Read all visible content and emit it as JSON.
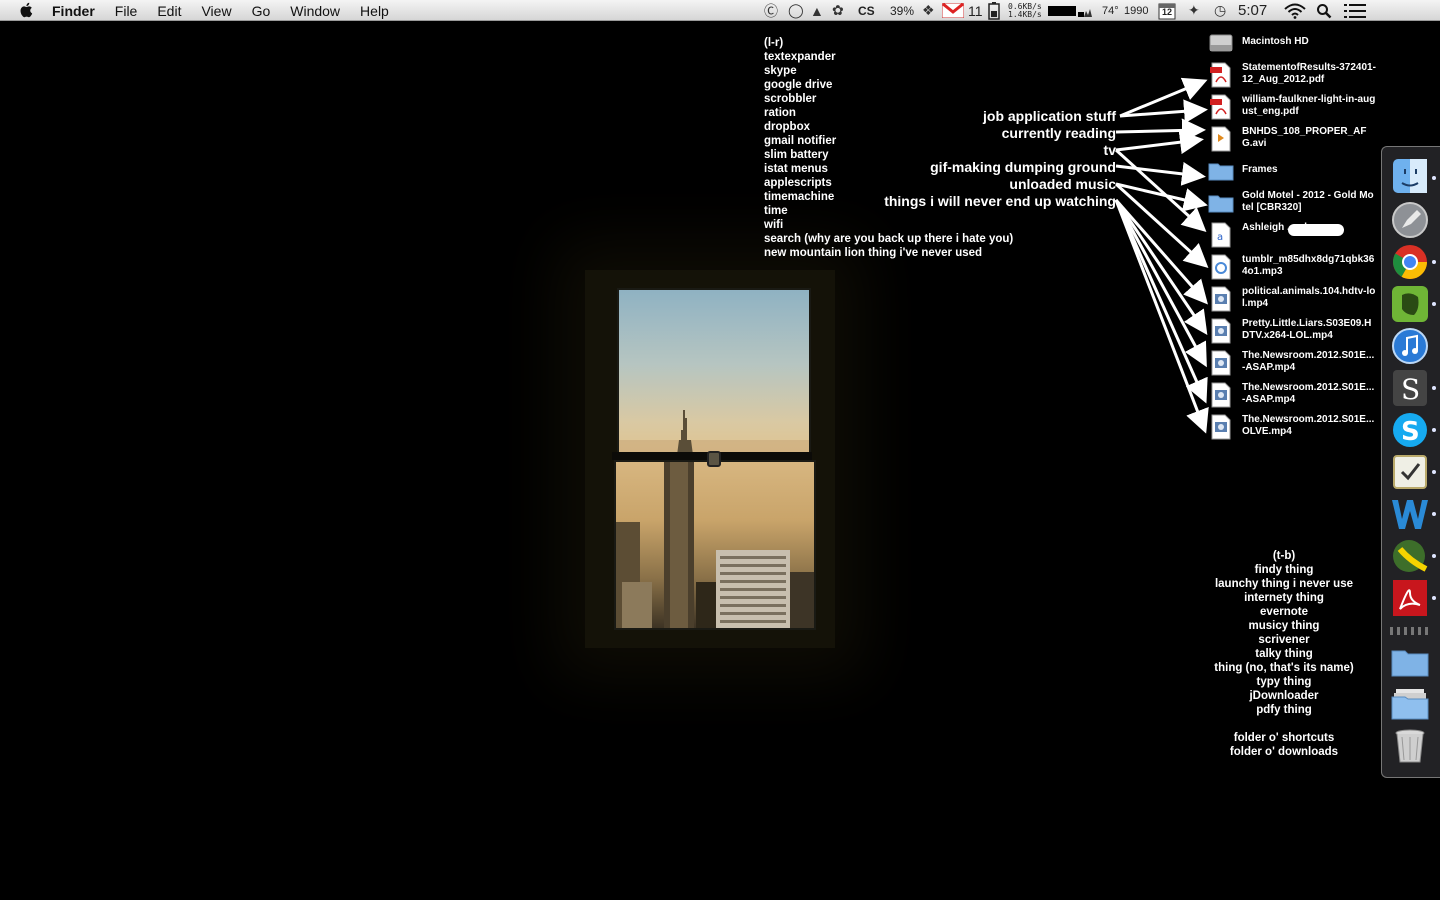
{
  "menubar": {
    "app": "Finder",
    "items": [
      "File",
      "Edit",
      "View",
      "Go",
      "Window",
      "Help"
    ],
    "battery_percent": "39%",
    "mail_count": "11",
    "net_up": "0.6KB/s",
    "net_down": "1.4KB/s",
    "temperature": "74°",
    "cpu_text": "1990",
    "calendar_day": "12",
    "clock": "5:07"
  },
  "note_lr": {
    "lines": [
      "(l-r)",
      "textexpander",
      "skype",
      "google drive",
      "scrobbler",
      "ration",
      "dropbox",
      "gmail notifier",
      "slim battery",
      "istat menus",
      "applescripts",
      "timemachine",
      "time",
      "wifi",
      "search (why are you back up there i hate you)",
      "new mountain lion thing i've never used"
    ]
  },
  "labels": {
    "job": "job application stuff",
    "reading": "currently reading",
    "tv": "tv",
    "gif": "gif-making dumping ground",
    "music": "unloaded music",
    "never": "things i will never end up watching"
  },
  "desktop": [
    {
      "name": "Macintosh HD",
      "icon": "hard-drive-icon"
    },
    {
      "name": "StatementofResults-372401-12_Aug_2012.pdf",
      "icon": "pdf-icon"
    },
    {
      "name": "william-faulkner-light-in-august_eng.pdf",
      "icon": "pdf-icon"
    },
    {
      "name": "BNHDS_108_PROPER_AFG.avi",
      "icon": "video-icon"
    },
    {
      "name": "Frames",
      "icon": "folder-icon"
    },
    {
      "name": "Gold Motel - 2012 - Gold Motel [CBR320]",
      "icon": "folder-icon"
    },
    {
      "name": "Ashleigh ... .docx",
      "icon": "document-icon"
    },
    {
      "name": "tumblr_m85dhx8dg71qbk364o1.mp3",
      "icon": "audio-icon"
    },
    {
      "name": "political.animals.104.hdtv-lol.mp4",
      "icon": "video-icon"
    },
    {
      "name": "Pretty.Little.Liars.S03E09.HDTV.x264-LOL.mp4",
      "icon": "video-icon"
    },
    {
      "name": "The.Newsroom.2012.S01E...-ASAP.mp4",
      "icon": "video-icon"
    },
    {
      "name": "The.Newsroom.2012.S01E...-ASAP.mp4",
      "icon": "video-icon"
    },
    {
      "name": "The.Newsroom.2012.S01E...OLVE.mp4",
      "icon": "video-icon"
    }
  ],
  "note_tb": {
    "lines": [
      "(t-b)",
      "findy thing",
      "launchy thing i never use",
      "internety thing",
      "evernote",
      "musicy thing",
      "scrivener",
      "talky thing",
      "thing (no, that's its name)",
      "typy thing",
      "jDownloader",
      "pdfy thing",
      "",
      "folder o' shortcuts",
      "folder o' downloads"
    ]
  },
  "dock": [
    {
      "name": "finder-icon",
      "running": true
    },
    {
      "name": "launchpad-icon",
      "running": false
    },
    {
      "name": "chrome-icon",
      "running": true
    },
    {
      "name": "evernote-icon",
      "running": true
    },
    {
      "name": "itunes-icon",
      "running": false
    },
    {
      "name": "scrivener-icon",
      "running": true
    },
    {
      "name": "skype-icon",
      "running": true
    },
    {
      "name": "things-icon",
      "running": true
    },
    {
      "name": "word-icon",
      "running": true
    },
    {
      "name": "jdownloader-icon",
      "running": true
    },
    {
      "name": "acrobat-icon",
      "running": true
    }
  ],
  "colors": {
    "accent_pdf": "#d22020",
    "folder": "#7fb3e6"
  }
}
